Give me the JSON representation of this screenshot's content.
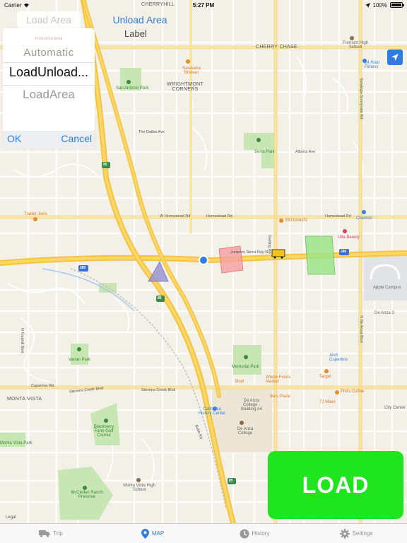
{
  "status_bar": {
    "carrier": "Carrier",
    "time": "5:27 PM",
    "battery": "100%"
  },
  "controls": {
    "load_area_label": "Load Area",
    "unload_area_label": "Unload Area",
    "label_text": "Label",
    "load_button_label": "LOAD",
    "locate_icon": "location-arrow-icon"
  },
  "picker": {
    "faint_item": "Find area area",
    "items": [
      "Automatic",
      "LoadUnload...",
      "LoadArea"
    ],
    "selected_index": 1,
    "ok_label": "OK",
    "cancel_label": "Cancel"
  },
  "tabs": [
    {
      "label": "Trip",
      "icon": "truck-icon",
      "active": false
    },
    {
      "label": "MAP",
      "icon": "map-pin-icon",
      "active": true
    },
    {
      "label": "History",
      "icon": "clock-icon",
      "active": false
    },
    {
      "label": "Settings",
      "icon": "gear-icon",
      "active": false
    }
  ],
  "map": {
    "legal": "Legal",
    "labels": {
      "cherryhill": "CHERRYHILL",
      "cherry_chase": "CHERRY CHASE",
      "wrightmont": "WRIGHTMONT CORNERS",
      "monta_vista": "MONTA VISTA",
      "fremont": "Fremont High School",
      "fitness": "24 Hour Fitness",
      "saravana": "Saravana Bhavan",
      "san_antonio": "San Antonio Park",
      "serra_park": "Serra Park",
      "alberta": "Alberta Ave",
      "dalles": "The Dalles Ave",
      "homestead": "W Homestead Rd",
      "homestead_e": "Homestead Rd",
      "mcdonalds": "McDonald's",
      "chevron": "Chevron",
      "ulta": "Ulta Beauty",
      "trader": "Trader Joe's",
      "junipero": "Junipero Serra Fwy N",
      "apple": "Apple Campus",
      "de_anza_3": "De Anza 3",
      "varian": "Varian Park",
      "memorial": "Memorial Park",
      "whole_foods": "Whole Foods Market",
      "target": "Target",
      "alofts": "Aloft Cupertino",
      "shell": "Shell",
      "ikes": "Ike's Place",
      "tj_maxx": "TJ Maxx",
      "phils": "Phil's Coffee",
      "city_center": "City Center",
      "stevens_creek": "Stevens Creek Blvd",
      "cupertino_rd": "Cupertino Rd",
      "history_center": "California History Center",
      "de_anza_college": "De Anza College",
      "de_anza_a4": "De Anza College - Building A4",
      "blackberry": "Blackberry Farm Golf Course",
      "monta_vista_park": "Monta Vista Park",
      "mcclellan": "McClellan Ranch Preserve",
      "monta_vista_hs": "Monta Vista High School",
      "stelling": "Stelling Rd",
      "de_anza_blvd": "N De Anza Blvd",
      "saratoga": "Saratoga-Sunnyvale Rd",
      "bubb": "Bubb Rd",
      "foothill": "N Foothill Blvd",
      "hwy85a": "85",
      "hwy85b": "85",
      "hwy85c": "85",
      "hwy280": "280",
      "hwy280b": "280"
    }
  }
}
